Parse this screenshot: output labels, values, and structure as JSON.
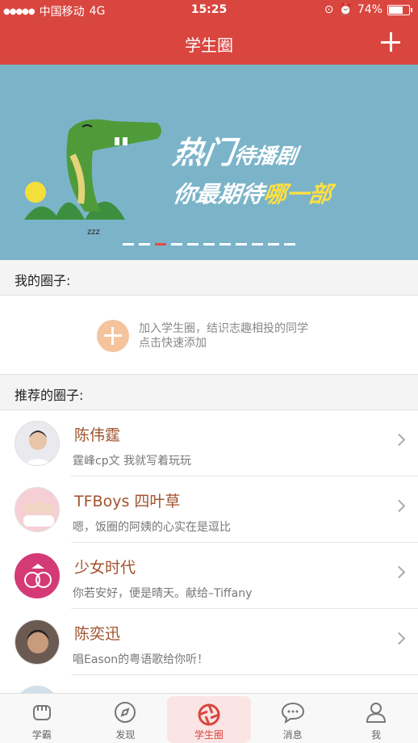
{
  "status_bar": {
    "carrier": "中国移动",
    "network": "4G",
    "time": "15:25",
    "battery_percent_label": "74%",
    "battery_level": 0.74
  },
  "nav": {
    "title": "学生圈"
  },
  "banner": {
    "line1_big": "热门",
    "line1_small": "待播剧",
    "line2_a": "你最期待",
    "line2_highlight": "哪一部",
    "zzz": "zzz",
    "page_count": 11,
    "active_page_index": 2
  },
  "my_circles": {
    "header": "我的圈子:",
    "add_line1": "加入学生圈，结识志趣相投的同学",
    "add_line2": "点击快速添加"
  },
  "recommended": {
    "header": "推荐的圈子:",
    "items": [
      {
        "name": "陈伟霆",
        "desc": "霆峰cp文 我就写着玩玩"
      },
      {
        "name": "TFBoys 四叶草",
        "desc": "嗯，饭圈的阿姨的心实在是逗比"
      },
      {
        "name": "少女时代",
        "desc": "你若安好，便是晴天。献给–Tiffany"
      },
      {
        "name": "陈奕迅",
        "desc": "唱Eason的粤语歌给你听！"
      },
      {
        "name": "",
        "desc": ""
      }
    ]
  },
  "tabbar": {
    "tabs": [
      {
        "label": "学霸",
        "icon": "fist-icon"
      },
      {
        "label": "发现",
        "icon": "compass-icon"
      },
      {
        "label": "学生圈",
        "icon": "aperture-icon"
      },
      {
        "label": "消息",
        "icon": "chat-bubble-icon"
      },
      {
        "label": "我",
        "icon": "person-icon"
      }
    ],
    "active_index": 2
  },
  "colors": {
    "brand_red": "#d9463f",
    "banner_bg": "#7bb4c9",
    "item_name": "#a0522d",
    "add_button": "#f5c39c"
  }
}
